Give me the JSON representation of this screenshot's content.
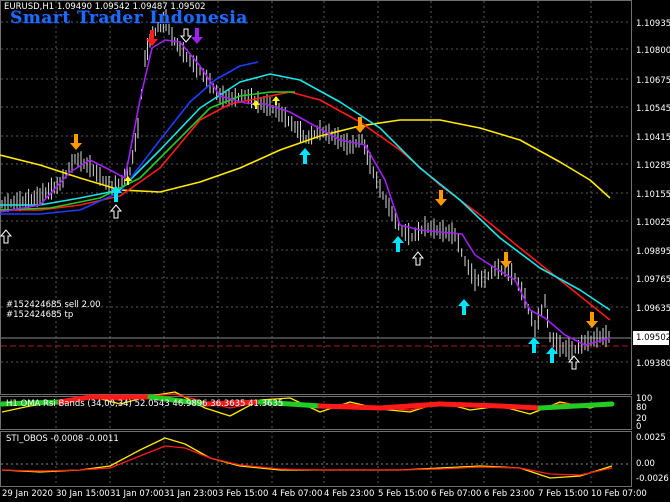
{
  "header": {
    "symbol_line": "EURUSD,H1  1.09490 1.09542 1.09487 1.09502",
    "watermark": "Smart Trader Indonesia"
  },
  "orders": {
    "sell": "#152424685 sell 2.00",
    "tp": "#152424685 tp"
  },
  "price_axis": [
    "1.10935",
    "1.10800",
    "1.10675",
    "1.10545",
    "1.10415",
    "1.10285",
    "1.10155",
    "1.10025",
    "1.09895",
    "1.09765",
    "1.09635",
    "1.09380"
  ],
  "current_price": "1.09502",
  "rsi_panel": {
    "label": "H1 OMA Rsi Bands (34,00,34) 52.0543 46.9896 36.3635 41.3635",
    "levels": [
      "100",
      "80",
      "20",
      "0"
    ]
  },
  "obos_panel": {
    "label": "STI_OBOS -0.0008 -0.0011",
    "levels": [
      "0.0025",
      "0.00",
      "-0.0026"
    ]
  },
  "time_axis": [
    "29 Jan 2020",
    "30 Jan 15:00",
    "31 Jan 07:00",
    "31 Jan 23:00",
    "3 Feb 15:00",
    "4 Feb 07:00",
    "4 Feb 23:00",
    "5 Feb 15:00",
    "6 Feb 07:00",
    "6 Feb 23:00",
    "7 Feb 15:00",
    "10 Feb 07:00"
  ],
  "colors": {
    "background": "#000000",
    "grid": "#5a5a5a",
    "candle": "#d8d8d8",
    "ma_red": "#ff1a1a",
    "ma_cyan": "#19e6e6",
    "ma_blue": "#1f3dff",
    "ma_green": "#22cc22",
    "ma_purple": "#a020f0",
    "ma_yellow": "#ffea00",
    "arrow_up_cyan": "#00e5ff",
    "arrow_down_orange": "#ff9900",
    "arrow_yellow": "#ffff00"
  }
}
